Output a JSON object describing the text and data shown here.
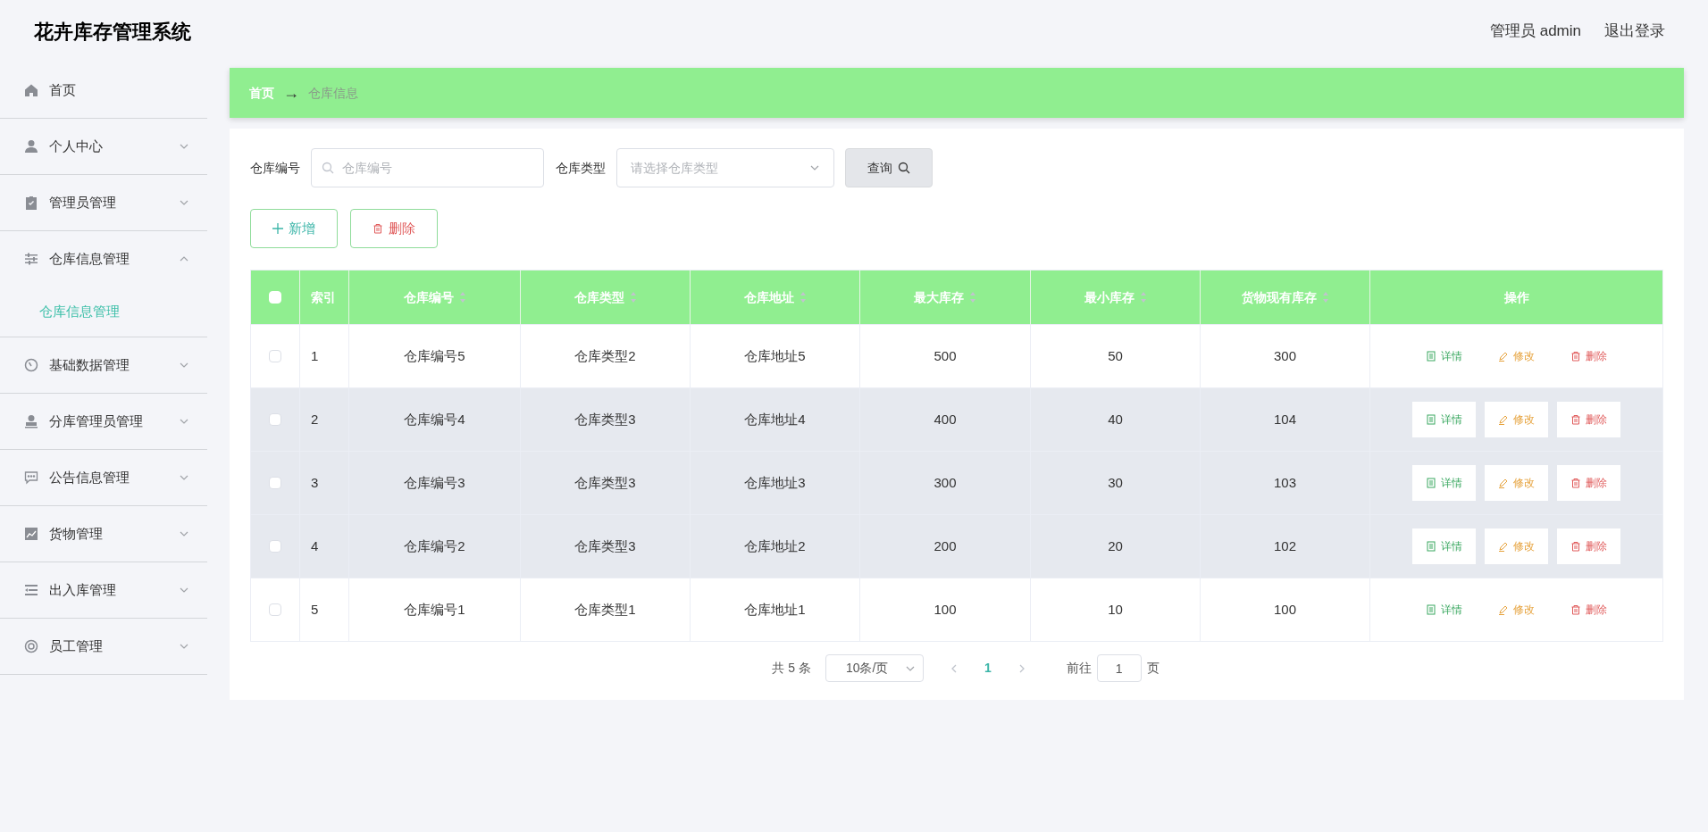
{
  "header": {
    "title": "花卉库存管理系统",
    "user": "管理员 admin",
    "logout": "退出登录"
  },
  "sidebar": {
    "items": [
      {
        "label": "首页"
      },
      {
        "label": "个人中心",
        "expanded": false
      },
      {
        "label": "管理员管理",
        "expanded": false
      },
      {
        "label": "仓库信息管理",
        "expanded": true,
        "children": [
          {
            "label": "仓库信息管理",
            "selected": true
          }
        ]
      },
      {
        "label": "基础数据管理",
        "expanded": false
      },
      {
        "label": "分库管理员管理",
        "expanded": false
      },
      {
        "label": "公告信息管理",
        "expanded": false
      },
      {
        "label": "货物管理",
        "expanded": false
      },
      {
        "label": "出入库管理",
        "expanded": false
      },
      {
        "label": "员工管理",
        "expanded": false
      }
    ]
  },
  "breadcrumb": {
    "home": "首页",
    "separator": "→",
    "current": "仓库信息"
  },
  "search": {
    "code_label": "仓库编号",
    "code_placeholder": "仓库编号",
    "type_label": "仓库类型",
    "type_placeholder": "请选择仓库类型",
    "query_button": "查询"
  },
  "actions": {
    "add": "新增",
    "delete": "删除"
  },
  "table": {
    "all_checked": false,
    "columns": [
      {
        "label": "索引",
        "sortable": false
      },
      {
        "label": "仓库编号",
        "sortable": true
      },
      {
        "label": "仓库类型",
        "sortable": true
      },
      {
        "label": "仓库地址",
        "sortable": true
      },
      {
        "label": "最大库存",
        "sortable": true
      },
      {
        "label": "最小库存",
        "sortable": true
      },
      {
        "label": "货物现有库存",
        "sortable": true
      },
      {
        "label": "操作",
        "sortable": false
      }
    ],
    "rows": [
      {
        "checked": false,
        "shaded": false,
        "cells": [
          "1",
          "仓库编号5",
          "仓库类型2",
          "仓库地址5",
          "500",
          "50",
          "300"
        ],
        "actions": [
          {
            "kind": "detail",
            "label": "详情"
          },
          {
            "kind": "edit",
            "label": "修改"
          },
          {
            "kind": "delete",
            "label": "删除"
          }
        ]
      },
      {
        "checked": false,
        "shaded": true,
        "cells": [
          "2",
          "仓库编号4",
          "仓库类型3",
          "仓库地址4",
          "400",
          "40",
          "104"
        ],
        "actions": [
          {
            "kind": "detail",
            "label": "详情"
          },
          {
            "kind": "edit",
            "label": "修改"
          },
          {
            "kind": "delete",
            "label": "删除"
          }
        ]
      },
      {
        "checked": false,
        "shaded": true,
        "cells": [
          "3",
          "仓库编号3",
          "仓库类型3",
          "仓库地址3",
          "300",
          "30",
          "103"
        ],
        "actions": [
          {
            "kind": "detail",
            "label": "详情"
          },
          {
            "kind": "edit",
            "label": "修改"
          },
          {
            "kind": "delete",
            "label": "删除"
          }
        ]
      },
      {
        "checked": false,
        "shaded": true,
        "cells": [
          "4",
          "仓库编号2",
          "仓库类型3",
          "仓库地址2",
          "200",
          "20",
          "102"
        ],
        "actions": [
          {
            "kind": "detail",
            "label": "详情"
          },
          {
            "kind": "edit",
            "label": "修改"
          },
          {
            "kind": "delete",
            "label": "删除"
          }
        ]
      },
      {
        "checked": false,
        "shaded": false,
        "cells": [
          "5",
          "仓库编号1",
          "仓库类型1",
          "仓库地址1",
          "100",
          "10",
          "100"
        ],
        "actions": [
          {
            "kind": "detail",
            "label": "详情"
          },
          {
            "kind": "edit",
            "label": "修改"
          },
          {
            "kind": "delete",
            "label": "删除"
          }
        ]
      }
    ]
  },
  "pagination": {
    "total": "共 5 条",
    "page_size": "10条/页",
    "pages": [
      {
        "label": "1",
        "selected": true
      }
    ],
    "goto_label": "前往",
    "goto_value": "1",
    "page_suffix": "页"
  }
}
